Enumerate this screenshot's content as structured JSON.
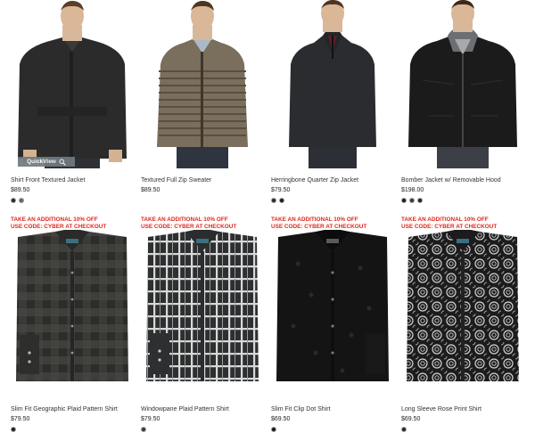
{
  "products_row1": [
    {
      "name": "Shirt Front Textured Jacket",
      "price": "$89.50",
      "swatches": [
        "#2a2a2a",
        "#6b6658"
      ],
      "promo_line1": "TAKE AN ADDITIONAL 10% OFF",
      "promo_line2": "USE CODE: CYBER AT CHECKOUT"
    },
    {
      "name": "Textured Full Zip Sweater",
      "price": "$89.50",
      "swatches": [],
      "promo_line1": "TAKE AN ADDITIONAL 10% OFF",
      "promo_line2": "USE CODE: CYBER AT CHECKOUT"
    },
    {
      "name": "Herringbone Quarter Zip Jacket",
      "price": "$79.50",
      "swatches": [
        "#2b2b2b",
        "#1d1d1d"
      ],
      "promo_line1": "TAKE AN ADDITIONAL 10% OFF",
      "promo_line2": "USE CODE: CYBER AT CHECKOUT"
    },
    {
      "name": "Bomber Jacket w/ Removable Hood",
      "price": "$198.00",
      "swatches": [
        "#1f1f1f",
        "#3a3a3a",
        "#242424"
      ],
      "promo_line1": "TAKE AN ADDITIONAL 10% OFF",
      "promo_line2": "USE CODE: CYBER AT CHECKOUT"
    }
  ],
  "products_row2": [
    {
      "name": "Slim Fit Geographic Plaid Pattern Shirt",
      "price": "$79.50",
      "swatches": [
        "#222222"
      ]
    },
    {
      "name": "Windowpane Plaid Pattern Shirt",
      "price": "$79.50",
      "swatches": [
        "#3a3a3a"
      ]
    },
    {
      "name": "Slim Fit Clip Dot Shirt",
      "price": "$69.50",
      "swatches": [
        "#1a1a1a"
      ]
    },
    {
      "name": "Long Sleeve Rose Print Shirt",
      "price": "$69.50",
      "swatches": [
        "#2a2a2a"
      ]
    }
  ],
  "quickview": {
    "label": "QuickView",
    "icon": "magnifier-icon"
  },
  "colors": {
    "promo": "#e0261b",
    "quickview_bg": "#6f7a80"
  }
}
